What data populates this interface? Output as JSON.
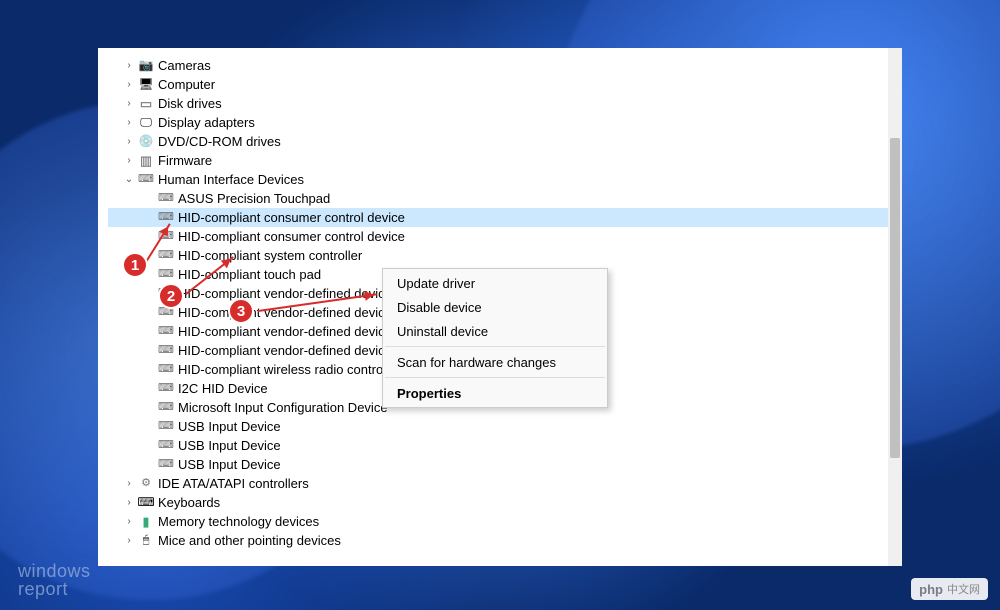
{
  "tree": {
    "cameras": "Cameras",
    "computer": "Computer",
    "disk_drives": "Disk drives",
    "display_adapters": "Display adapters",
    "dvd": "DVD/CD-ROM drives",
    "firmware": "Firmware",
    "hid_category": "Human Interface Devices",
    "hid_children": [
      "ASUS Precision Touchpad",
      "HID-compliant consumer control device",
      "HID-compliant consumer control device",
      "HID-compliant system controller",
      "HID-compliant touch pad",
      "HID-compliant vendor-defined device",
      "HID-compliant vendor-defined device",
      "HID-compliant vendor-defined device",
      "HID-compliant vendor-defined device",
      "HID-compliant wireless radio controls",
      "I2C HID Device",
      "Microsoft Input Configuration Device",
      "USB Input Device",
      "USB Input Device",
      "USB Input Device"
    ],
    "ide": "IDE ATA/ATAPI controllers",
    "keyboards": "Keyboards",
    "memory": "Memory technology devices",
    "mice": "Mice and other pointing devices"
  },
  "context_menu": {
    "update": "Update driver",
    "disable": "Disable device",
    "uninstall": "Uninstall device",
    "scan": "Scan for hardware changes",
    "properties": "Properties"
  },
  "annotations": {
    "badge1": "1",
    "badge2": "2",
    "badge3": "3"
  },
  "watermarks": {
    "left_l1": "windows",
    "left_l2": "report",
    "right_php": "php",
    "right_cn": "中文网"
  }
}
